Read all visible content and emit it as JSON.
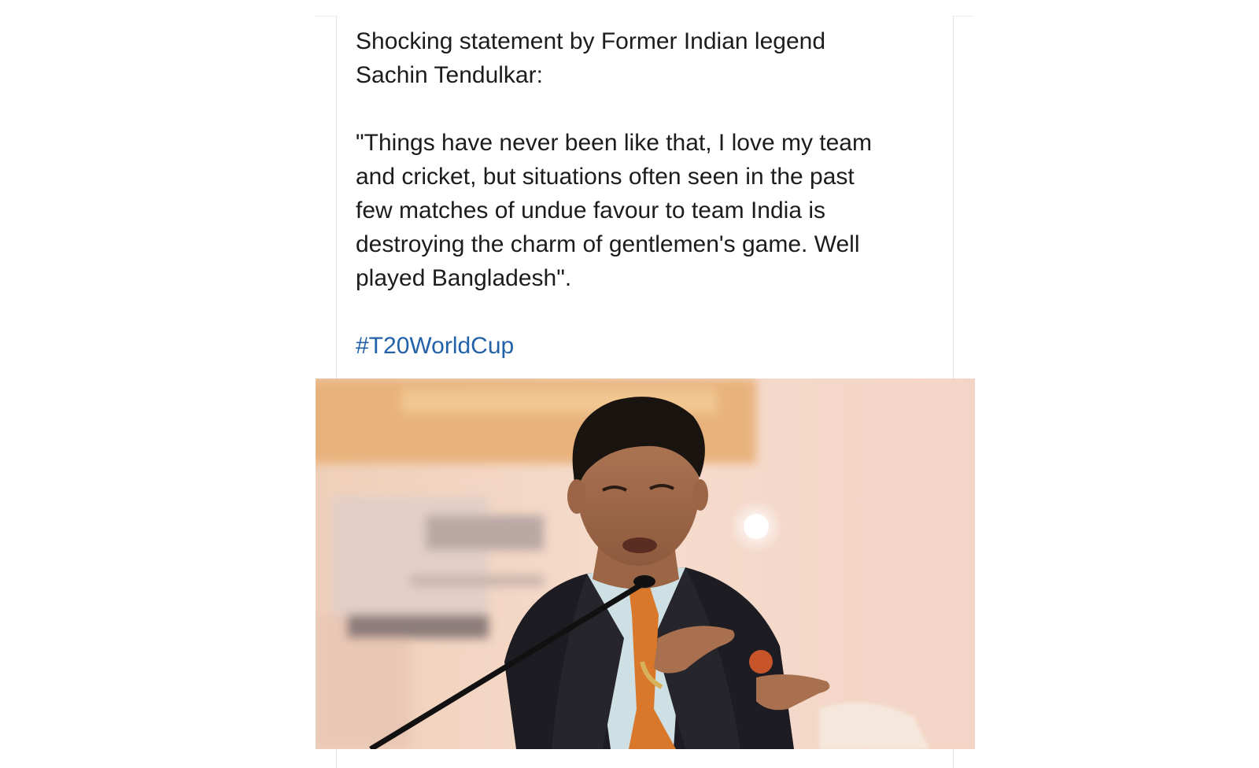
{
  "post": {
    "intro": "Shocking statement by Former Indian legend\nSachin Tendulkar:",
    "quote": "\"Things have never been like that, I love my team\nand cricket, but situations often seen in the past\nfew matches of undue favour to team India is\ndestroying the charm of gentlemen's game. Well\nplayed Bangladesh\".",
    "hashtag": "#T20WorldCup"
  },
  "photo": {
    "subject": "man in dark suit speaking into microphone",
    "background_colors": [
      "#f3d8c7",
      "#e9b784",
      "#c9b6ad"
    ],
    "suit_color": "#1d1c22",
    "tie_color": "#d9782a"
  },
  "colors": {
    "text": "#1c1c1c",
    "link": "#2361a8",
    "divider": "#e2e2e2"
  }
}
